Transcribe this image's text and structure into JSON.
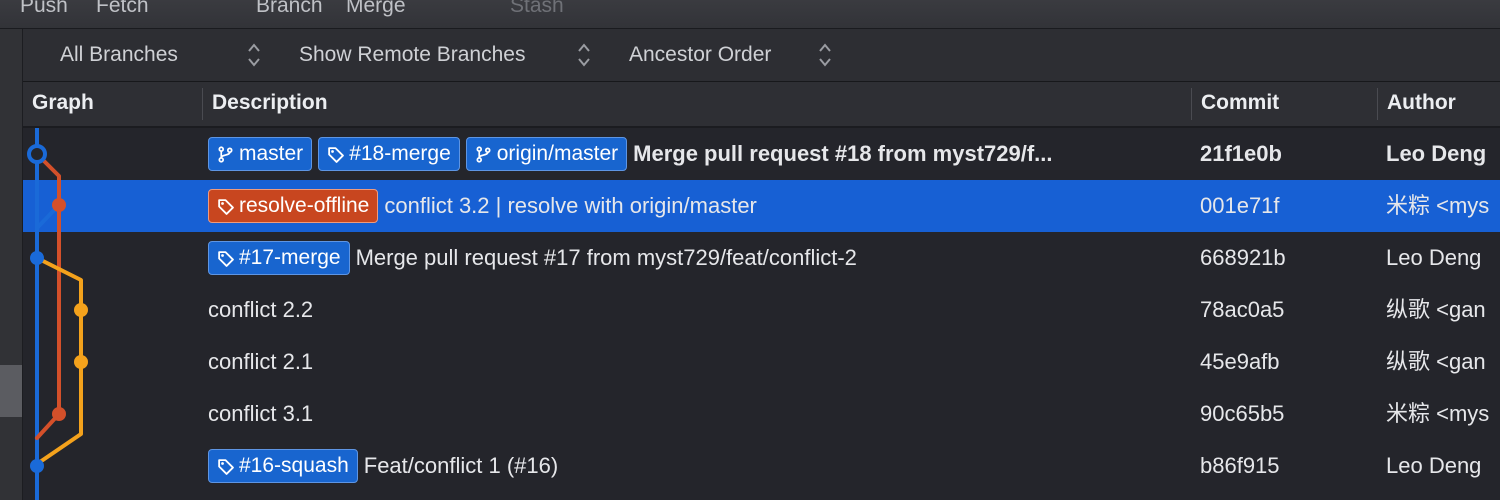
{
  "toolbar": {
    "items": [
      {
        "label": "Push",
        "dim": false
      },
      {
        "label": "Fetch",
        "dim": false
      },
      {
        "label": "Branch",
        "dim": false
      },
      {
        "label": "Merge",
        "dim": false
      },
      {
        "label": "Stash",
        "dim": true
      }
    ]
  },
  "filters": {
    "branches": "All Branches",
    "remote": "Show Remote Branches",
    "order": "Ancestor Order"
  },
  "columns": {
    "graph": "Graph",
    "description": "Description",
    "commit": "Commit",
    "author": "Author"
  },
  "graph_colors": {
    "blue": "#1a6ad8",
    "orange_red": "#d4502a",
    "yellow": "#f4a21c"
  },
  "commits": [
    {
      "badges": [
        {
          "type": "branch",
          "label": "master"
        },
        {
          "type": "tag",
          "label": "#18-merge"
        },
        {
          "type": "branch",
          "label": "origin/master"
        }
      ],
      "message": "Merge pull request #18 from myst729/f...",
      "hash": "21f1e0b",
      "author": "Leo Deng",
      "bold": true,
      "selected": false
    },
    {
      "badges": [
        {
          "type": "tag-orange",
          "label": "resolve-offline"
        }
      ],
      "message": "conflict 3.2 | resolve with origin/master",
      "hash": "001e71f",
      "author": "米粽 <mys",
      "bold": false,
      "selected": true
    },
    {
      "badges": [
        {
          "type": "tag",
          "label": "#17-merge"
        }
      ],
      "message": "Merge pull request #17 from myst729/feat/conflict-2",
      "hash": "668921b",
      "author": "Leo Deng",
      "bold": false,
      "selected": false
    },
    {
      "badges": [],
      "message": "conflict 2.2",
      "hash": "78ac0a5",
      "author": "纵歌 <gan",
      "bold": false,
      "selected": false
    },
    {
      "badges": [],
      "message": "conflict 2.1",
      "hash": "45e9afb",
      "author": "纵歌 <gan",
      "bold": false,
      "selected": false
    },
    {
      "badges": [],
      "message": "conflict 3.1",
      "hash": "90c65b5",
      "author": "米粽 <mys",
      "bold": false,
      "selected": false
    },
    {
      "badges": [
        {
          "type": "tag",
          "label": "#16-squash"
        }
      ],
      "message": "Feat/conflict 1 (#16)",
      "hash": "b86f915",
      "author": "Leo Deng",
      "bold": false,
      "selected": false
    }
  ]
}
